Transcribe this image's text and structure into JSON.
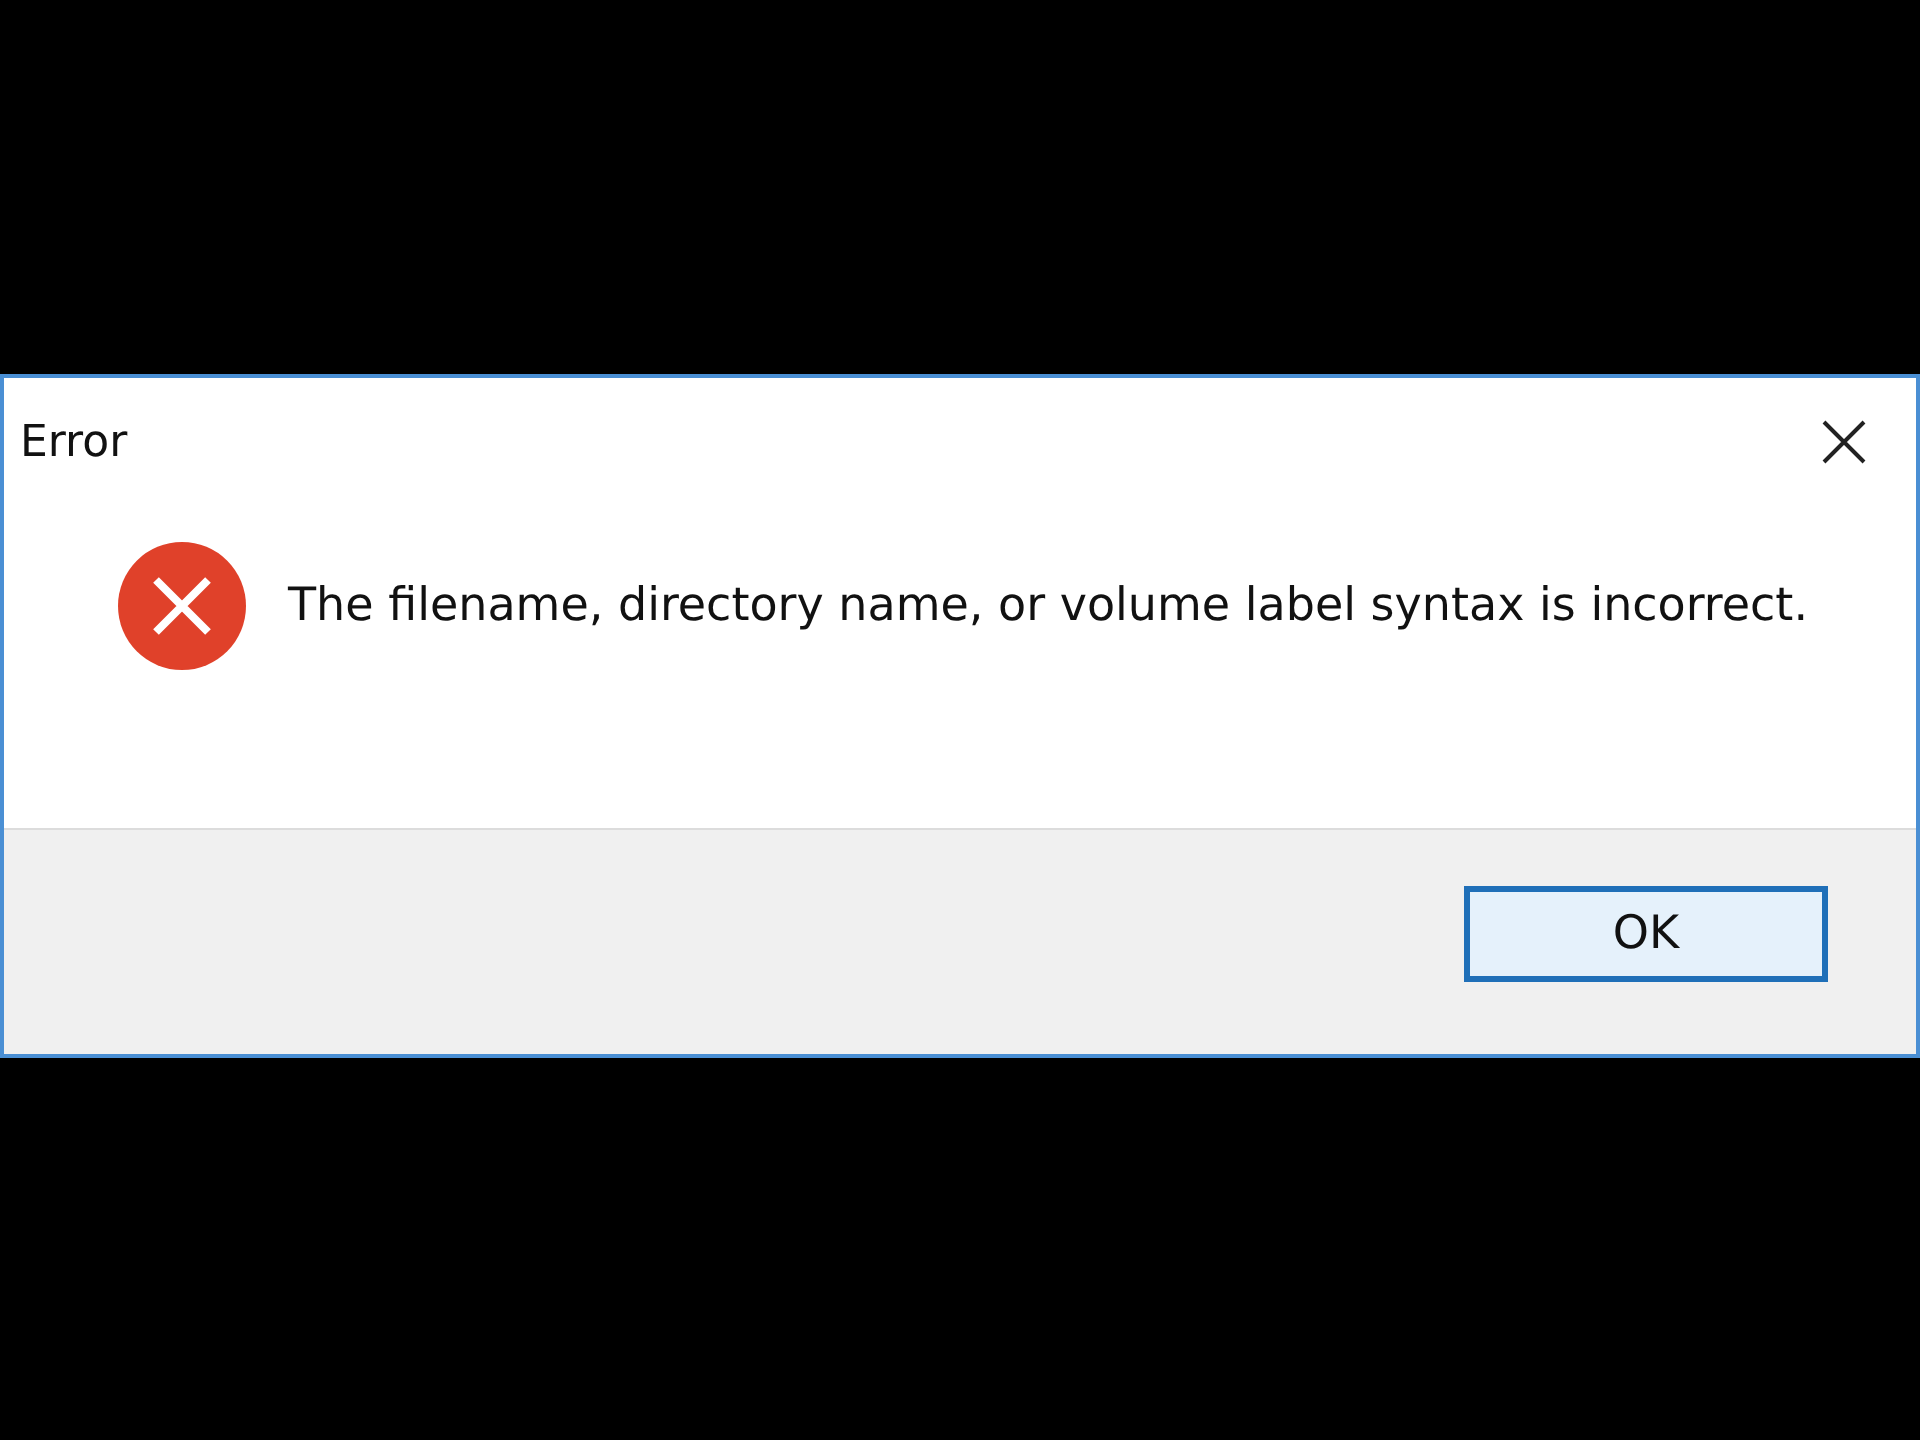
{
  "window": {
    "title": "Error"
  },
  "message": "The filename, directory name, or volume label syntax is incorrect.",
  "buttons": [
    {
      "label": "OK",
      "selected": true
    }
  ]
}
